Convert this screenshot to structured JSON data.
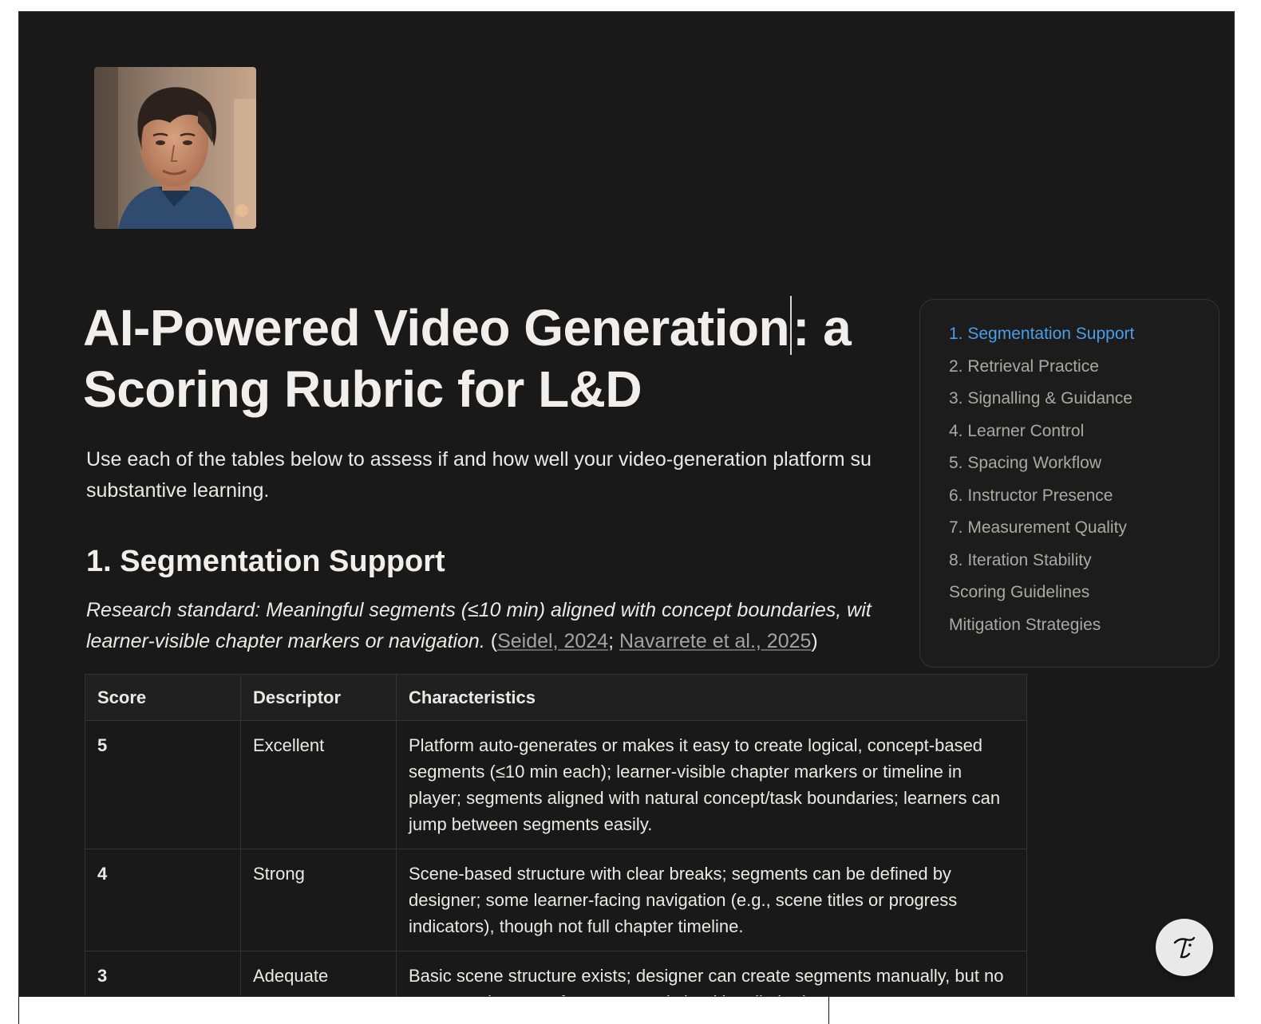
{
  "page": {
    "title_part1": "AI-Powered Video Generation",
    "title_part2": ": a Scoring Rubric for L&D",
    "intro": "Use each of the tables below to assess if and how well your video-generation platform su",
    "intro_line2": "substantive learning."
  },
  "section1": {
    "heading": "1. Segmentation Support",
    "standard_text_line1": "Research standard: Meaningful segments (≤10 min) aligned with concept boundaries, wit",
    "standard_text_line2": "learner-visible chapter markers or navigation.",
    "cite_open": " (",
    "cite1": "Seidel, 2024",
    "cite_sep": "; ",
    "cite2": "Navarrete et al., 2025",
    "cite_close": ")",
    "table": {
      "headers": [
        "Score",
        "Descriptor",
        "Characteristics"
      ],
      "rows": [
        {
          "score": "5",
          "descriptor": "Excellent",
          "characteristics": "Platform auto-generates or makes it easy to create logical, concept-based segments (≤10 min each); learner-visible chapter markers or timeline in player; segments aligned with natural concept/task boundaries; learners can jump between segments easily."
        },
        {
          "score": "4",
          "descriptor": "Strong",
          "characteristics": "Scene-based structure with clear breaks; segments can be defined by designer; some learner-facing navigation (e.g., scene titles or progress indicators), though not full chapter timeline."
        },
        {
          "score": "3",
          "descriptor": "Adequate",
          "characteristics": "Basic scene structure exists; designer can create segments manually, but no automated support for conceptual chunking; limited or no"
        }
      ]
    }
  },
  "toc": {
    "items": [
      "1. Segmentation Support",
      "2. Retrieval Practice",
      "3. Signalling & Guidance",
      "4. Learner Control",
      "5. Spacing Workflow",
      "6. Instructor Presence",
      "7. Measurement Quality",
      "8. Iteration Stability",
      "Scoring Guidelines",
      "Mitigation Strategies"
    ],
    "active_index": 0
  },
  "colors": {
    "background": "#191919",
    "text": "#e9e9e7",
    "accent": "#4a9ee8",
    "muted": "#a9a9a6"
  },
  "icons": {
    "help": "help-icon"
  }
}
